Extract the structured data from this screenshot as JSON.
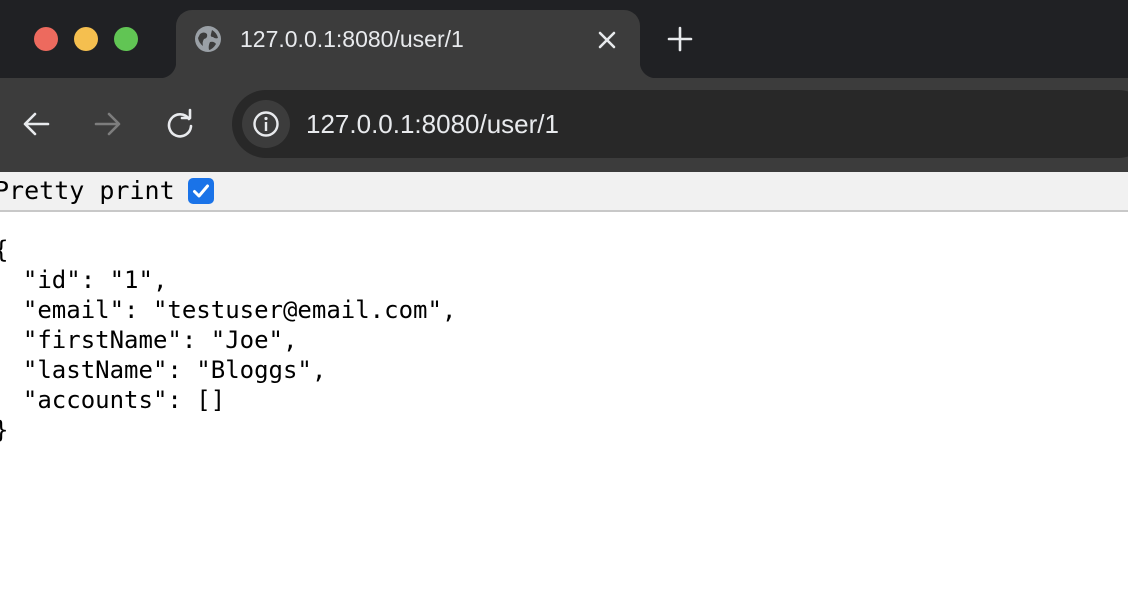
{
  "browser": {
    "tab_title": "127.0.0.1:8080/user/1",
    "url": "127.0.0.1:8080/user/1",
    "icons": {
      "window_controls": [
        "close-icon",
        "minimize-icon",
        "zoom-icon"
      ],
      "tab": [
        "globe-icon",
        "close-icon"
      ],
      "new_tab": "plus-icon",
      "navigation": [
        "back-arrow-icon",
        "forward-arrow-icon",
        "reload-icon"
      ],
      "site_info": "info-icon"
    },
    "colors": {
      "tabstrip": "#202124",
      "toolbar": "#3c3c3c",
      "omnibox": "#282828",
      "traffic_red": "#ed6a5e",
      "traffic_yellow": "#f5bf4f",
      "traffic_green": "#61c554"
    }
  },
  "page": {
    "pretty_print_label": "Pretty print",
    "pretty_print_checked": true,
    "json_lines": [
      "{",
      "  \"id\": \"1\",",
      "  \"email\": \"testuser@email.com\",",
      "  \"firstName\": \"Joe\",",
      "  \"lastName\": \"Bloggs\",",
      "  \"accounts\": []",
      "}"
    ],
    "checkbox_color": "#1a73e8"
  }
}
